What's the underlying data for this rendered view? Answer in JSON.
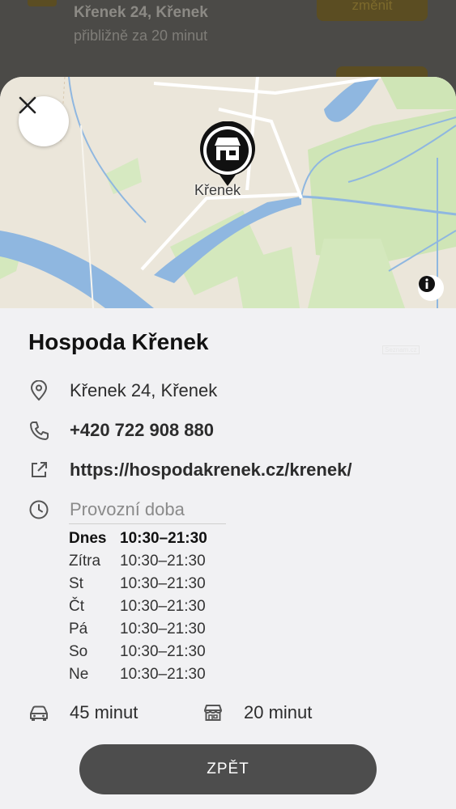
{
  "background": {
    "address": "Křenek 24, Křenek",
    "eta": "přibližně za 20 minut",
    "change_button": "změnit"
  },
  "map": {
    "place_label": "Křenek",
    "pin_icon": "store-icon",
    "attribution": "Seznam.cz"
  },
  "place": {
    "name": "Hospoda Křenek",
    "address": "Křenek 24, Křenek",
    "phone": "+420 722 908 880",
    "website": "https://hospodakrenek.cz/krenek/",
    "hours_label": "Provozní doba",
    "hours": [
      {
        "day": "Dnes",
        "time": "10:30–21:30"
      },
      {
        "day": "Zítra",
        "time": "10:30–21:30"
      },
      {
        "day": "St",
        "time": "10:30–21:30"
      },
      {
        "day": "Čt",
        "time": "10:30–21:30"
      },
      {
        "day": "Pá",
        "time": "10:30–21:30"
      },
      {
        "day": "So",
        "time": "10:30–21:30"
      },
      {
        "day": "Ne",
        "time": "10:30–21:30"
      }
    ]
  },
  "travel": {
    "car": "45 minut",
    "store": "20 minut"
  },
  "back_button": "ZPĚT",
  "colors": {
    "sheet": "#f1f1f3",
    "button": "#4d4d4d",
    "water": "#8fb7e0",
    "green": "#cfe5b6"
  }
}
